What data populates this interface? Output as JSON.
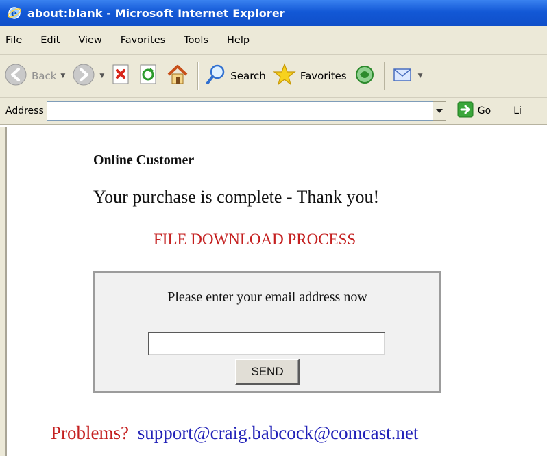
{
  "window": {
    "title": "about:blank - Microsoft Internet Explorer"
  },
  "menu": {
    "items": [
      "File",
      "Edit",
      "View",
      "Favorites",
      "Tools",
      "Help"
    ]
  },
  "toolbar": {
    "back_label": "Back",
    "search_label": "Search",
    "favorites_label": "Favorites"
  },
  "address_bar": {
    "label": "Address",
    "value": "",
    "go_label": "Go",
    "links_label": "Li"
  },
  "page": {
    "customer_heading": "Online Customer",
    "thanks_heading": "Your purchase is complete - Thank you!",
    "process_heading": "FILE DOWNLOAD PROCESS",
    "form": {
      "prompt": "Please enter your email address now",
      "email_value": "",
      "send_label": "SEND"
    },
    "problems_label": "Problems?",
    "support_email": "support@craig.babcock@comcast.net"
  },
  "colors": {
    "title_bar": "#1358d6",
    "chrome": "#ece9d8",
    "alert_red": "#c42020",
    "link_blue": "#2222b8"
  },
  "icons": [
    "ie-logo-icon",
    "back-icon",
    "forward-icon",
    "stop-icon",
    "refresh-icon",
    "home-icon",
    "search-icon",
    "favorites-star-icon",
    "media-icon",
    "mail-icon",
    "go-arrow-icon",
    "dropdown-arrow-icon"
  ]
}
